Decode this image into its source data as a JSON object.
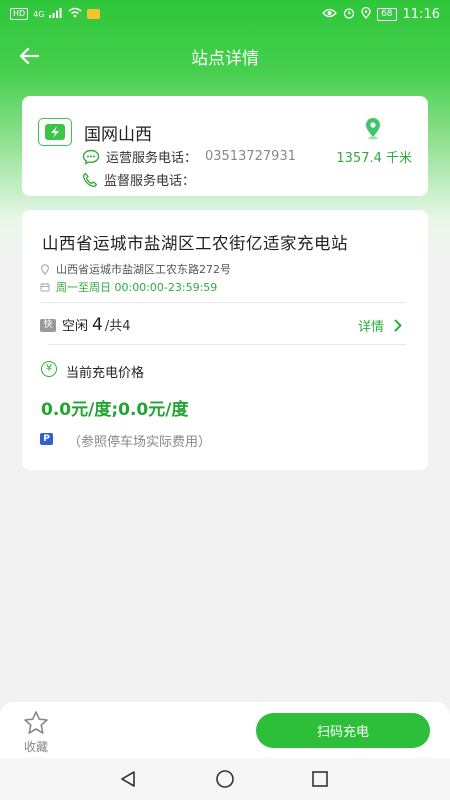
{
  "status_bar": {
    "hd": "HD",
    "network": "4G",
    "battery": "68",
    "time": "11:16"
  },
  "header": {
    "title": "站点详情"
  },
  "operator": {
    "name": "国网山西",
    "ops_phone_label": "运营服务电话：",
    "ops_phone": "03513727931",
    "supervision_phone_label": "监督服务电话：",
    "distance": "1357.4 千米"
  },
  "station": {
    "name": "山西省运城市盐湖区工农街亿适家充电站",
    "address": "山西省运城市盐湖区工农东路272号",
    "hours": "周一至周日 00:00:00-23:59:59",
    "pile_badge": "快",
    "free_label": "空闲",
    "free_count": "4",
    "total": "/共4",
    "detail_label": "详情",
    "price_icon": "¥",
    "price_title": "当前充电价格",
    "price_value": "0.0元/度;0.0元/度",
    "parking_badge": "P",
    "parking_note": "（参照停车场实际费用）"
  },
  "bottom": {
    "favorite_label": "收藏",
    "scan_label": "扫码充电"
  },
  "colors": {
    "brand_green": "#2dbf3a",
    "text_green": "#2eab3c",
    "parking_blue": "#2f5fd1"
  }
}
